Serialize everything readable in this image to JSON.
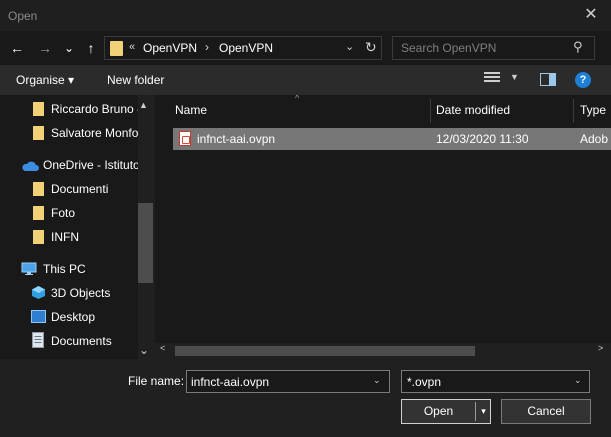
{
  "window": {
    "title": "Open",
    "close_label": "✕"
  },
  "nav": {
    "back_icon": "←",
    "forward_icon": "→",
    "recent_icon": "⌄",
    "up_icon": "↑",
    "breadcrumb_chevron": "«",
    "breadcrumbs": [
      "OpenVPN",
      "OpenVPN"
    ],
    "separator": "›",
    "dropdown_icon": "⌄",
    "refresh_icon": "↻",
    "search_placeholder": "Search OpenVPN",
    "search_icon": "⚲"
  },
  "toolbar": {
    "organise_label": "Organise ▾",
    "new_folder_label": "New folder",
    "view_dropdown_icon": "▼",
    "help_label": "?"
  },
  "sidebar": {
    "items": [
      {
        "label": "Riccardo Bruno -",
        "type": "folder"
      },
      {
        "label": "Salvatore Monfo",
        "type": "folder"
      },
      {
        "label": "OneDrive - Istituto",
        "type": "onedrive"
      },
      {
        "label": "Documenti",
        "type": "folder"
      },
      {
        "label": "Foto",
        "type": "folder"
      },
      {
        "label": "INFN",
        "type": "folder"
      },
      {
        "label": "This PC",
        "type": "pc"
      },
      {
        "label": "3D Objects",
        "type": "3d"
      },
      {
        "label": "Desktop",
        "type": "desktop"
      },
      {
        "label": "Documents",
        "type": "documents"
      }
    ],
    "scroll_up": "▲",
    "scroll_down": "⌄"
  },
  "filelist": {
    "columns": [
      "Name",
      "Date modified",
      "Type"
    ],
    "sort_indicator": "^",
    "rows": [
      {
        "name": "infnct-aai.ovpn",
        "date": "12/03/2020 11:30",
        "type": "Adob"
      }
    ],
    "scroll_left": "<",
    "scroll_right": ">"
  },
  "footer": {
    "filename_label": "File name:",
    "filename_value": "infnct-aai.ovpn",
    "filetype_value": "*.ovpn",
    "dropdown_icon": "⌄",
    "open_label": "Open",
    "open_arrow": "▾",
    "cancel_label": "Cancel"
  },
  "colors": {
    "selection": "#777777",
    "folder": "#f3d277",
    "accent": "#1e7fd6"
  }
}
